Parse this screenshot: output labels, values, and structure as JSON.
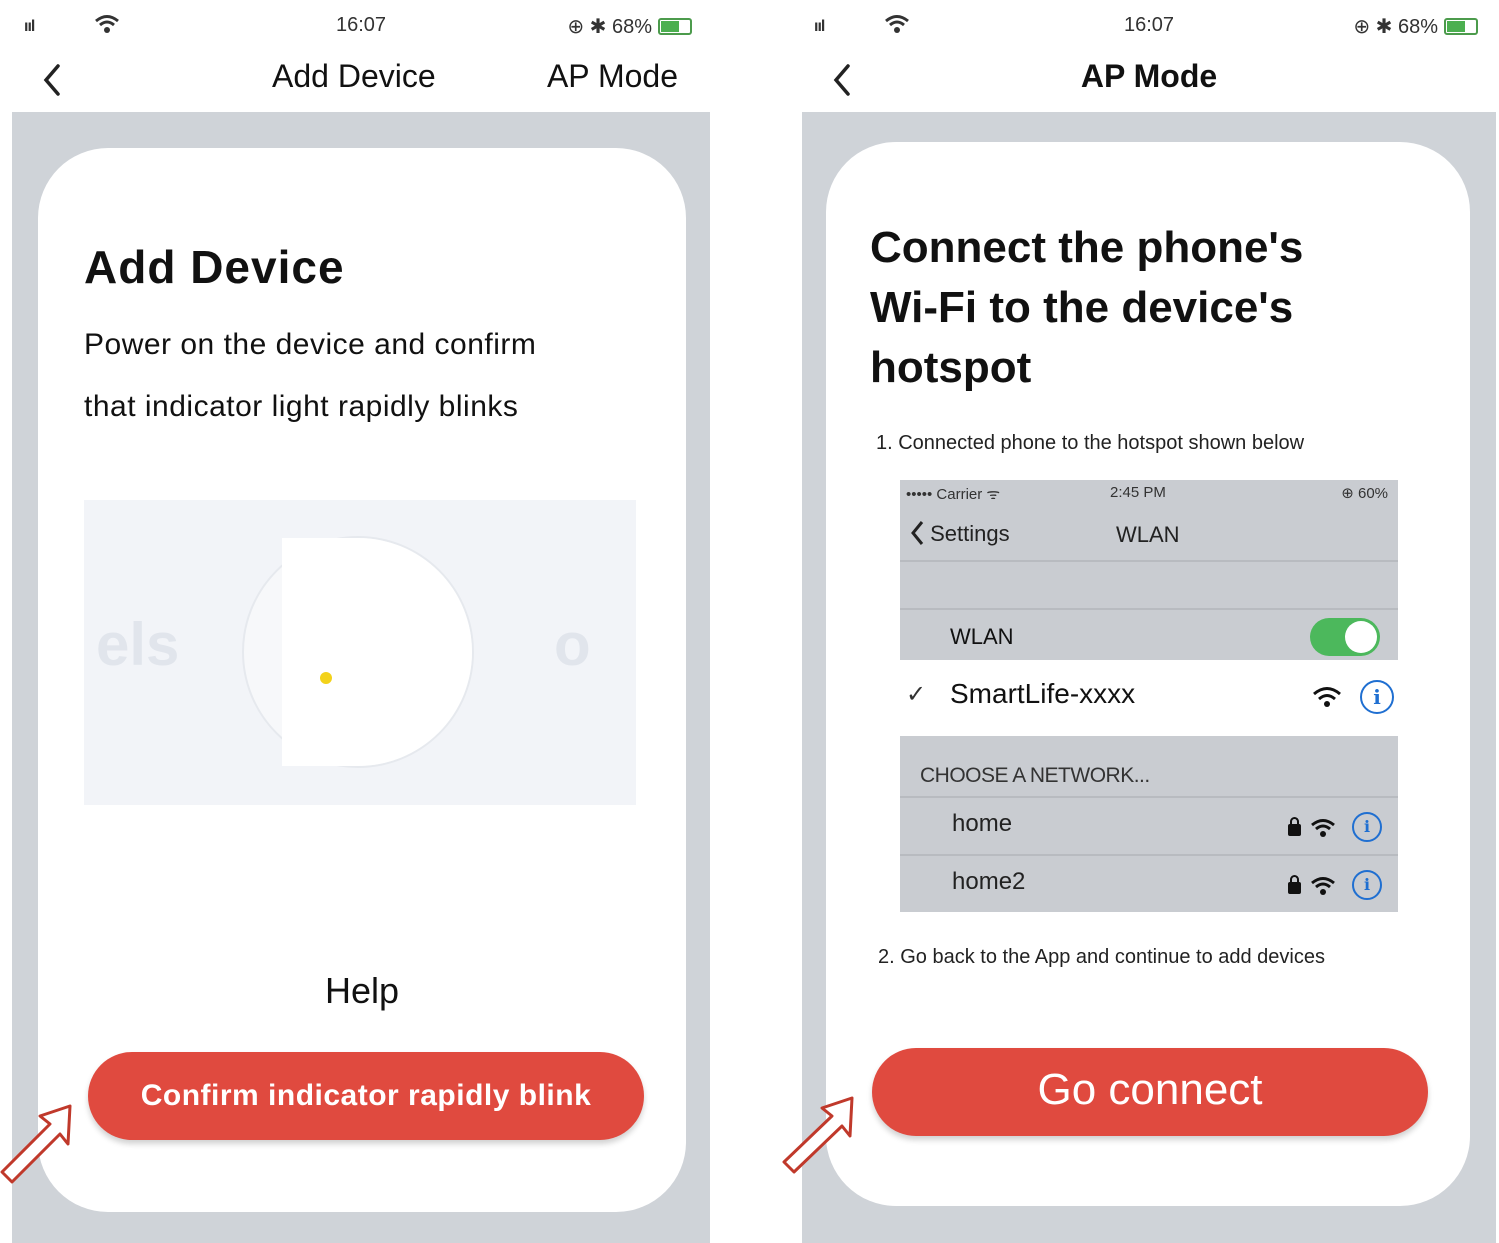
{
  "left_screen": {
    "status": {
      "signal": "ııl",
      "time": "16:07",
      "right": "⊕ ✱ 68%"
    },
    "nav": {
      "title": "Add Device",
      "action": "AP Mode"
    },
    "heading": "Add Device",
    "description_line1": "Power on the device and confirm",
    "description_line2": "that indicator light rapidly blinks",
    "illustration_ghost_left": "els",
    "illustration_ghost_right": "o",
    "help_label": "Help",
    "confirm_button": "Confirm indicator rapidly blink"
  },
  "right_screen": {
    "status": {
      "signal": "ııl",
      "time": "16:07",
      "right": "⊕ ✱ 68%"
    },
    "nav": {
      "title": "AP Mode"
    },
    "heading_line1": "Connect the phone's",
    "heading_line2": "Wi-Fi to the device's",
    "heading_line3": "hotspot",
    "step1": "1. Connected phone to the hotspot shown below",
    "wlan_screenshot": {
      "carrier": "••••• Carrier ᯤ",
      "time": "2:45 PM",
      "status_right": "⊕ 60%",
      "back_label": "Settings",
      "title": "WLAN",
      "wlan_label": "WLAN",
      "toggle_on": true,
      "connected_check": "✓",
      "connected_network": "SmartLife-xxxx",
      "choose_label": "CHOOSE A NETWORK...",
      "networks": [
        {
          "name": "home"
        },
        {
          "name": "home2"
        }
      ]
    },
    "step2": "2. Go back to the App and continue to add devices",
    "go_button": "Go connect"
  },
  "colors": {
    "accent": "#e04a3f",
    "background_gray": "#cfd3d8",
    "toggle_green": "#4cb85c",
    "info_blue": "#1f6fd1"
  }
}
